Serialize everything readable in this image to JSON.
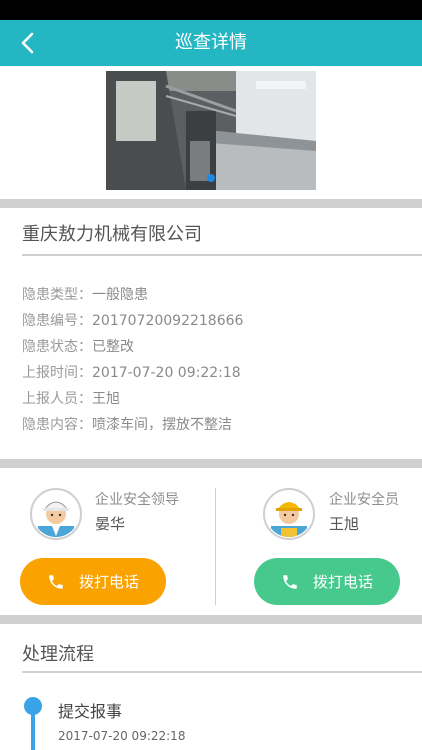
{
  "header": {
    "title": "巡查详情",
    "back_icon": "chevron-left-icon"
  },
  "company_name": "重庆敖力机械有限公司",
  "details": [
    {
      "key": "隐患类型：",
      "value": "一般隐患"
    },
    {
      "key": "隐患编号：",
      "value": "20170720092218666"
    },
    {
      "key": "隐患状态：",
      "value": "已整改"
    },
    {
      "key": "上报时间：",
      "value": "2017-07-20 09:22:18"
    },
    {
      "key": "上报人员：",
      "value": "王旭"
    },
    {
      "key": "隐患内容：",
      "value": "喷漆车间，摆放不整洁"
    }
  ],
  "contacts": [
    {
      "role": "企业安全领导",
      "name": "晏华",
      "button": "拨打电话",
      "color": "#f9a200"
    },
    {
      "role": "企业安全员",
      "name": "王旭",
      "button": "拨打电话",
      "color": "#47c98d"
    }
  ],
  "process": {
    "title": "处理流程",
    "steps": [
      {
        "title": "提交报事",
        "time": "2017-07-20 09:22:18"
      }
    ]
  },
  "colors": {
    "primary": "#24b7c3",
    "timeline": "#3aa3e8"
  }
}
